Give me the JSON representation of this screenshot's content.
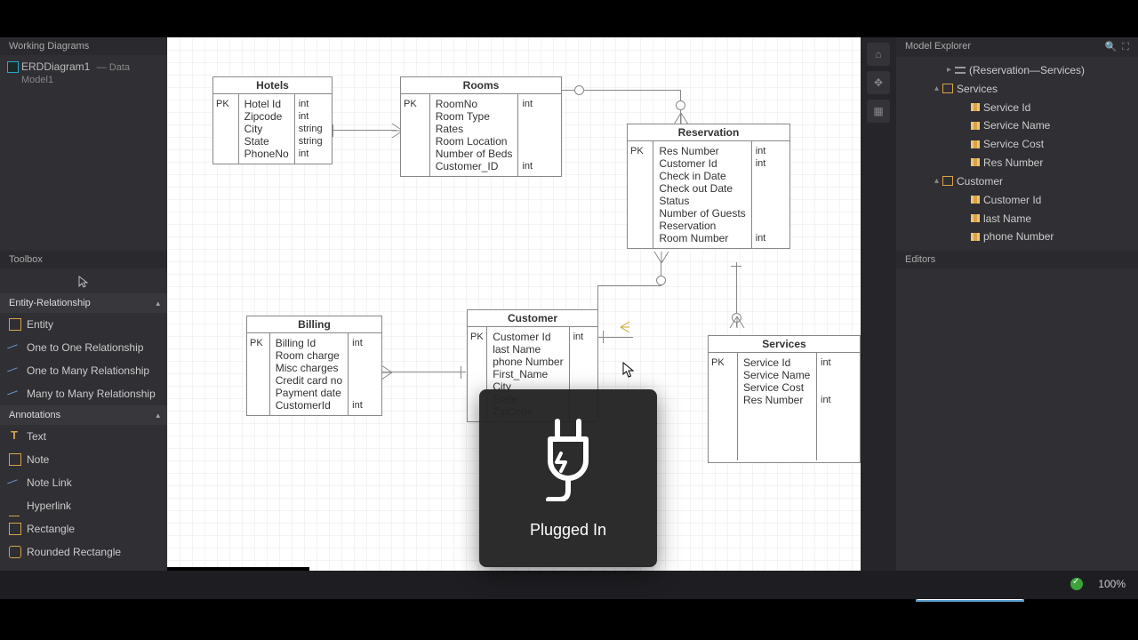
{
  "working": {
    "title": "Working Diagrams",
    "item": "ERDDiagram1",
    "sub": "— Data Model1"
  },
  "toolbox": {
    "title": "Toolbox",
    "group_er": "Entity-Relationship",
    "tools_er": [
      "Entity",
      "One to One Relationship",
      "One to Many Relationship",
      "Many to Many Relationship"
    ],
    "group_ann": "Annotations",
    "tools_ann": [
      "Text",
      "Note",
      "Note Link",
      "Hyperlink",
      "Rectangle",
      "Rounded Rectangle"
    ]
  },
  "explorer": {
    "title": "Model Explorer",
    "rows": [
      {
        "indent": 54,
        "tw": "▸",
        "ico": "link",
        "label": "(Reservation—Services)"
      },
      {
        "indent": 40,
        "tw": "▴",
        "ico": "ent",
        "label": "Services"
      },
      {
        "indent": 72,
        "tw": "",
        "ico": "col",
        "label": "Service Id"
      },
      {
        "indent": 72,
        "tw": "",
        "ico": "col",
        "label": "Service Name"
      },
      {
        "indent": 72,
        "tw": "",
        "ico": "col",
        "label": "Service Cost"
      },
      {
        "indent": 72,
        "tw": "",
        "ico": "col",
        "label": "Res Number"
      },
      {
        "indent": 40,
        "tw": "▴",
        "ico": "ent",
        "label": "Customer"
      },
      {
        "indent": 72,
        "tw": "",
        "ico": "col",
        "label": "Customer Id"
      },
      {
        "indent": 72,
        "tw": "",
        "ico": "col",
        "label": "last Name"
      },
      {
        "indent": 72,
        "tw": "",
        "ico": "col",
        "label": "phone Number"
      }
    ]
  },
  "editors": {
    "title": "Editors"
  },
  "status": {
    "zoom": "100%"
  },
  "toast": {
    "label": "Plugged In"
  },
  "entities": {
    "hotels": {
      "title": "Hotels",
      "pk": "PK",
      "rows": [
        [
          "Hotel Id",
          "int"
        ],
        [
          "Zipcode",
          "int"
        ],
        [
          "City",
          "string"
        ],
        [
          "State",
          "string"
        ],
        [
          "PhoneNo",
          "int"
        ]
      ]
    },
    "rooms": {
      "title": "Rooms",
      "pk": "PK",
      "rows": [
        [
          "RoomNo",
          "int"
        ],
        [
          "Room Type",
          ""
        ],
        [
          "Rates",
          ""
        ],
        [
          "Room Location",
          ""
        ],
        [
          "Number of Beds",
          ""
        ],
        [
          "Customer_ID",
          "int"
        ]
      ]
    },
    "reservation": {
      "title": "Reservation",
      "pk": "PK",
      "rows": [
        [
          "Res Number",
          "int"
        ],
        [
          "Customer Id",
          "int"
        ],
        [
          "Check in Date",
          ""
        ],
        [
          "Check out Date",
          ""
        ],
        [
          "Status",
          ""
        ],
        [
          "Number of Guests",
          ""
        ],
        [
          "Reservation",
          ""
        ],
        [
          "Room Number",
          "int"
        ]
      ]
    },
    "billing": {
      "title": "Billing",
      "pk": "PK",
      "rows": [
        [
          "Billing Id",
          "int"
        ],
        [
          "Room charge",
          ""
        ],
        [
          "Misc charges",
          ""
        ],
        [
          "Credit card no",
          ""
        ],
        [
          "Payment date",
          ""
        ],
        [
          "CustomerId",
          "int"
        ]
      ]
    },
    "customer": {
      "title": "Customer",
      "pk": "PK",
      "rows": [
        [
          "Customer Id",
          "int"
        ],
        [
          "last Name",
          ""
        ],
        [
          "phone Number",
          ""
        ],
        [
          "First_Name",
          ""
        ],
        [
          "City",
          ""
        ],
        [
          "State",
          ""
        ],
        [
          "ZipCode",
          ""
        ]
      ]
    },
    "services": {
      "title": "Services",
      "pk": "PK",
      "rows": [
        [
          "Service Id",
          "int"
        ],
        [
          "Service Name",
          ""
        ],
        [
          "Service Cost",
          ""
        ],
        [
          "Res Number",
          "int"
        ]
      ]
    }
  }
}
